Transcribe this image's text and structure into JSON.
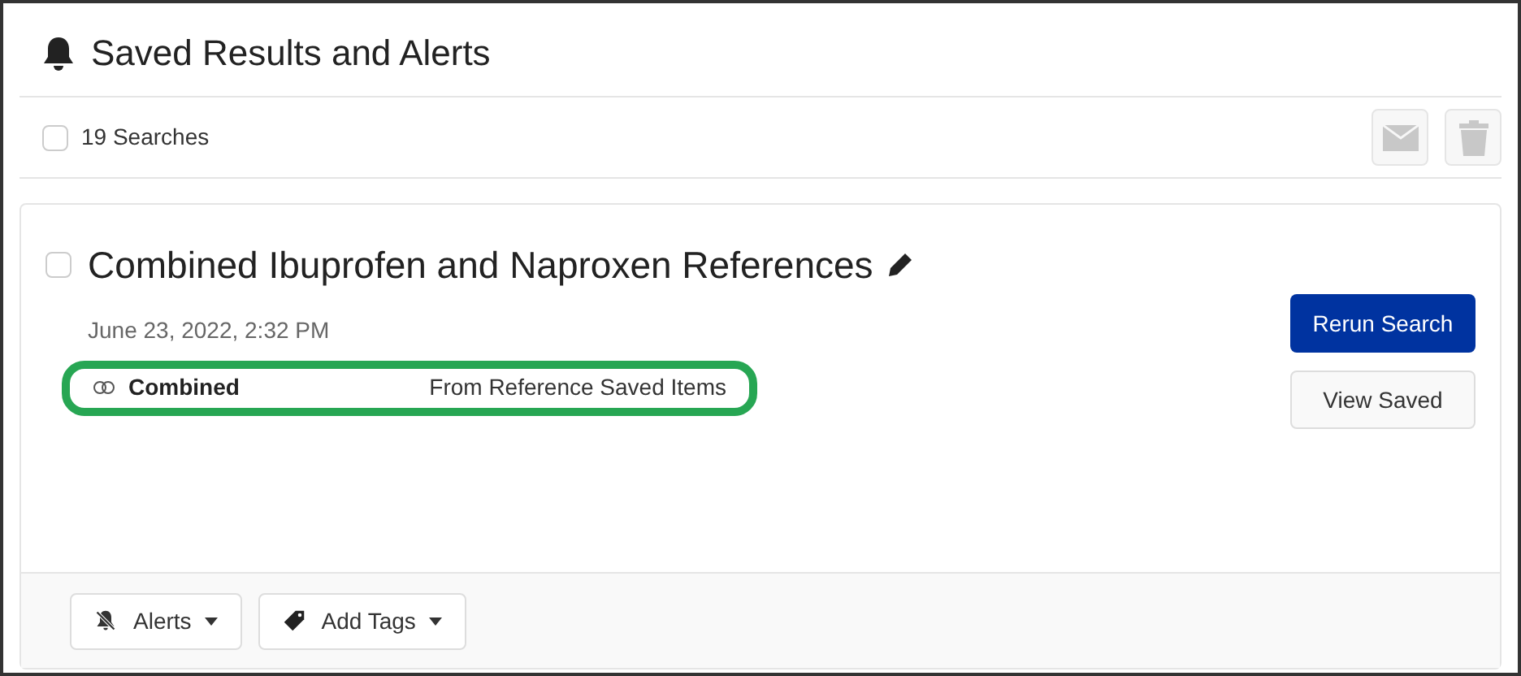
{
  "title": "Saved Results and Alerts",
  "toolbar": {
    "select_all": {
      "checked": false
    },
    "count": "19 Searches",
    "email_disabled": true,
    "delete_disabled": true
  },
  "searches": [
    {
      "checked": false,
      "title": "Combined Ibuprofen and Naproxen References",
      "date": "June 23, 2022, 2:32 PM",
      "highlighted": true,
      "type_label": "Combined",
      "source": "From Reference Saved Items",
      "actions": [
        {
          "label": "Rerun Search",
          "kind": "primary"
        },
        {
          "label": "View Saved",
          "kind": "secondary"
        }
      ],
      "footer": [
        {
          "label": "Alerts",
          "kind": "alerts"
        },
        {
          "label": "Add Tags",
          "kind": "tags"
        }
      ]
    }
  ]
}
